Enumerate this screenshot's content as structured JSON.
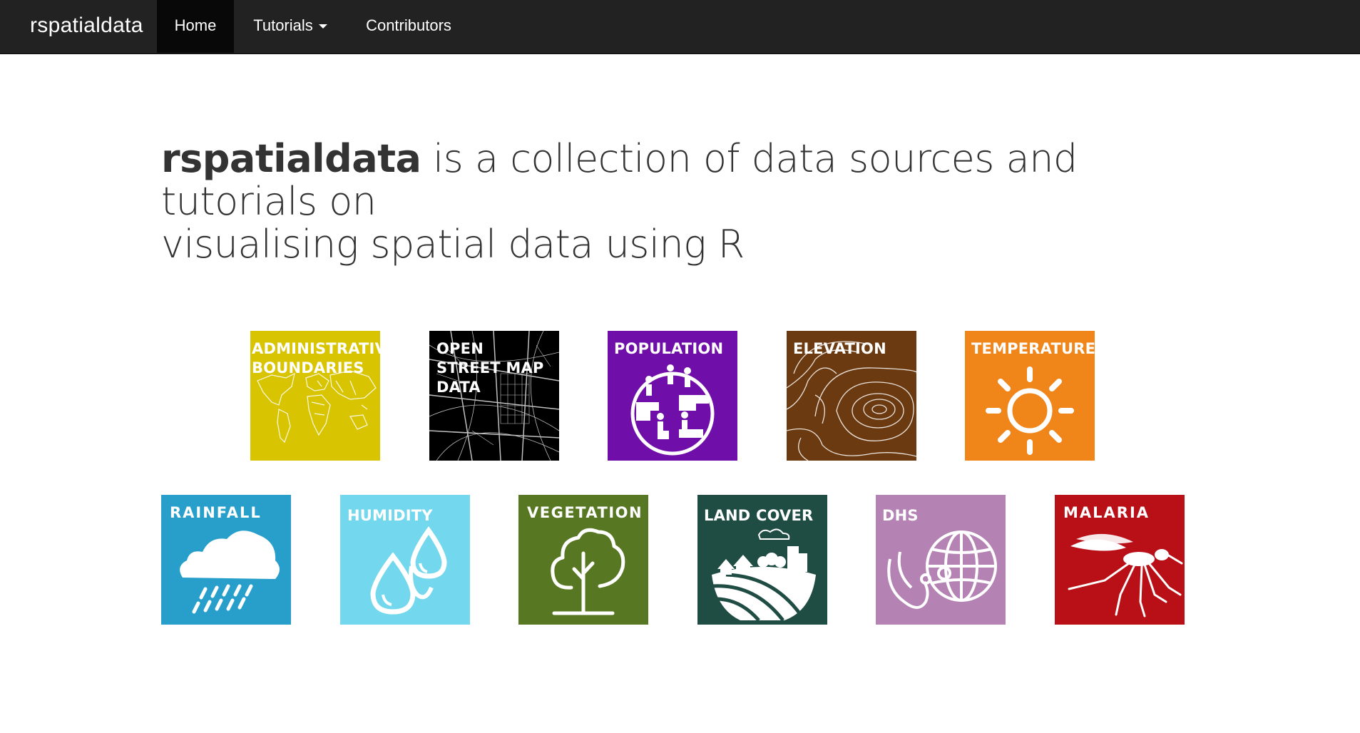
{
  "navbar": {
    "brand": "rspatialdata",
    "items": [
      {
        "label": "Home",
        "active": true
      },
      {
        "label": "Tutorials",
        "dropdown": true
      },
      {
        "label": "Contributors"
      }
    ]
  },
  "hero": {
    "brand_word": "rspatialdata",
    "rest_line1": " is a collection of data sources and tutorials on",
    "line2": "visualising spatial data using R"
  },
  "tiles": [
    {
      "label": "Administrative Boundaries",
      "color": "#d8c401",
      "icon": "world-map-icon"
    },
    {
      "label": "Open Street Map Data",
      "color": "#000000",
      "icon": "street-map-icon"
    },
    {
      "label": "Population",
      "color": "#6f0ea8",
      "icon": "people-globe-icon"
    },
    {
      "label": "Elevation",
      "color": "#6b3a10",
      "icon": "contour-lines-icon"
    },
    {
      "label": "Temperature",
      "color": "#f0851a",
      "icon": "sun-icon"
    },
    {
      "label": "Rainfall",
      "color": "#289fcb",
      "icon": "rain-cloud-icon"
    },
    {
      "label": "Humidity",
      "color": "#73d8ee",
      "icon": "water-drops-icon"
    },
    {
      "label": "Vegetation",
      "color": "#577722",
      "icon": "tree-icon"
    },
    {
      "label": "Land Cover",
      "color": "#1f4d44",
      "icon": "landscape-icon"
    },
    {
      "label": "DHS",
      "color": "#b482b3",
      "icon": "stethoscope-globe-icon"
    },
    {
      "label": "Malaria",
      "color": "#b91017",
      "icon": "mosquito-icon"
    }
  ]
}
